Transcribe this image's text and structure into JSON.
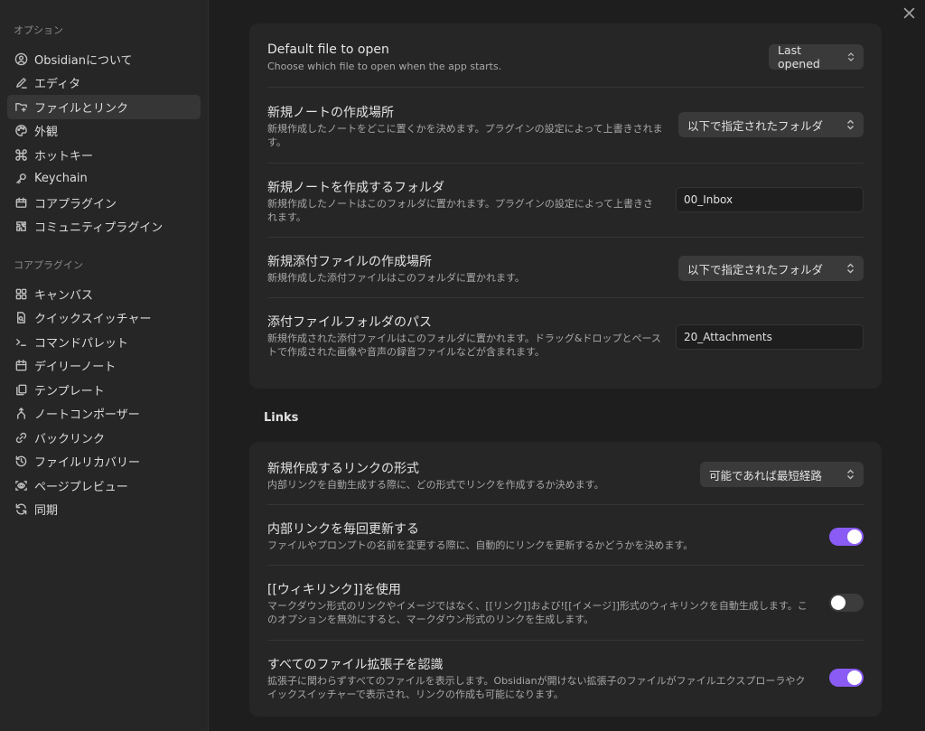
{
  "sidebar": {
    "options_heading": "オプション",
    "options": [
      {
        "label": "Obsidianについて",
        "icon": "info-circle-icon"
      },
      {
        "label": "エディタ",
        "icon": "pencil-icon"
      },
      {
        "label": "ファイルとリンク",
        "icon": "folder-link-icon",
        "active": true
      },
      {
        "label": "外観",
        "icon": "palette-icon"
      },
      {
        "label": "ホットキー",
        "icon": "command-icon"
      },
      {
        "label": "Keychain",
        "icon": "key-icon"
      },
      {
        "label": "コアプラグイン",
        "icon": "plug-icon"
      },
      {
        "label": "コミュニティプラグイン",
        "icon": "puzzle-icon"
      }
    ],
    "core_heading": "コアプラグイン",
    "core": [
      {
        "label": "キャンバス",
        "icon": "grid-icon"
      },
      {
        "label": "クイックスイッチャー",
        "icon": "file-search-icon"
      },
      {
        "label": "コマンドパレット",
        "icon": "terminal-icon"
      },
      {
        "label": "デイリーノート",
        "icon": "calendar-icon"
      },
      {
        "label": "テンプレート",
        "icon": "copy-icon"
      },
      {
        "label": "ノートコンポーザー",
        "icon": "merge-icon"
      },
      {
        "label": "バックリンク",
        "icon": "link-icon"
      },
      {
        "label": "ファイルリカバリー",
        "icon": "history-icon"
      },
      {
        "label": "ページプレビュー",
        "icon": "scan-eye-icon"
      },
      {
        "label": "同期",
        "icon": "sync-icon"
      }
    ]
  },
  "files": {
    "default_file": {
      "title": "Default file to open",
      "desc": "Choose which file to open when the app starts.",
      "value": "Last opened"
    },
    "new_note_location": {
      "title": "新規ノートの作成場所",
      "desc": "新規作成したノートをどこに置くかを決めます。プラグインの設定によって上書きされます。",
      "value": "以下で指定されたフォルダ"
    },
    "new_note_folder": {
      "title": "新規ノートを作成するフォルダ",
      "desc": "新規作成したノートはこのフォルダに置かれます。プラグインの設定によって上書きされます。",
      "value": "00_Inbox"
    },
    "attachment_location": {
      "title": "新規添付ファイルの作成場所",
      "desc": "新規作成した添付ファイルはこのフォルダに置かれます。",
      "value": "以下で指定されたフォルダ"
    },
    "attachment_path": {
      "title": "添付ファイルフォルダのパス",
      "desc": "新規作成された添付ファイルはこのフォルダに置かれます。ドラッグ&ドロップとペーストで作成された画像や音声の録音ファイルなどが含まれます。",
      "value": "20_Attachments"
    }
  },
  "links": {
    "heading": "Links",
    "link_format": {
      "title": "新規作成するリンクの形式",
      "desc": "内部リンクを自動生成する際に、どの形式でリンクを作成するか決めます。",
      "value": "可能であれば最短経路"
    },
    "auto_update": {
      "title": "内部リンクを毎回更新する",
      "desc": "ファイルやプロンプトの名前を変更する際に、自動的にリンクを更新するかどうかを決めます。",
      "on": true
    },
    "wikilinks": {
      "title": "[[ウィキリンク]]を使用",
      "desc": "マークダウン形式のリンクやイメージではなく、[[リンク]]および![[イメージ]]形式のウィキリンクを自動生成します。このオプションを無効にすると、マークダウン形式のリンクを生成します。",
      "on": false
    },
    "all_extensions": {
      "title": "すべてのファイル拡張子を認識",
      "desc": "拡張子に関わらずすべてのファイルを表示します。Obsidianが開けない拡張子のファイルがファイルエクスプローラやクイックスイッチャーで表示され、リンクの作成も可能になります。",
      "on": true
    }
  },
  "colors": {
    "accent": "#8a5cf5",
    "background": "#1e1e1e",
    "panel": "#262626"
  }
}
